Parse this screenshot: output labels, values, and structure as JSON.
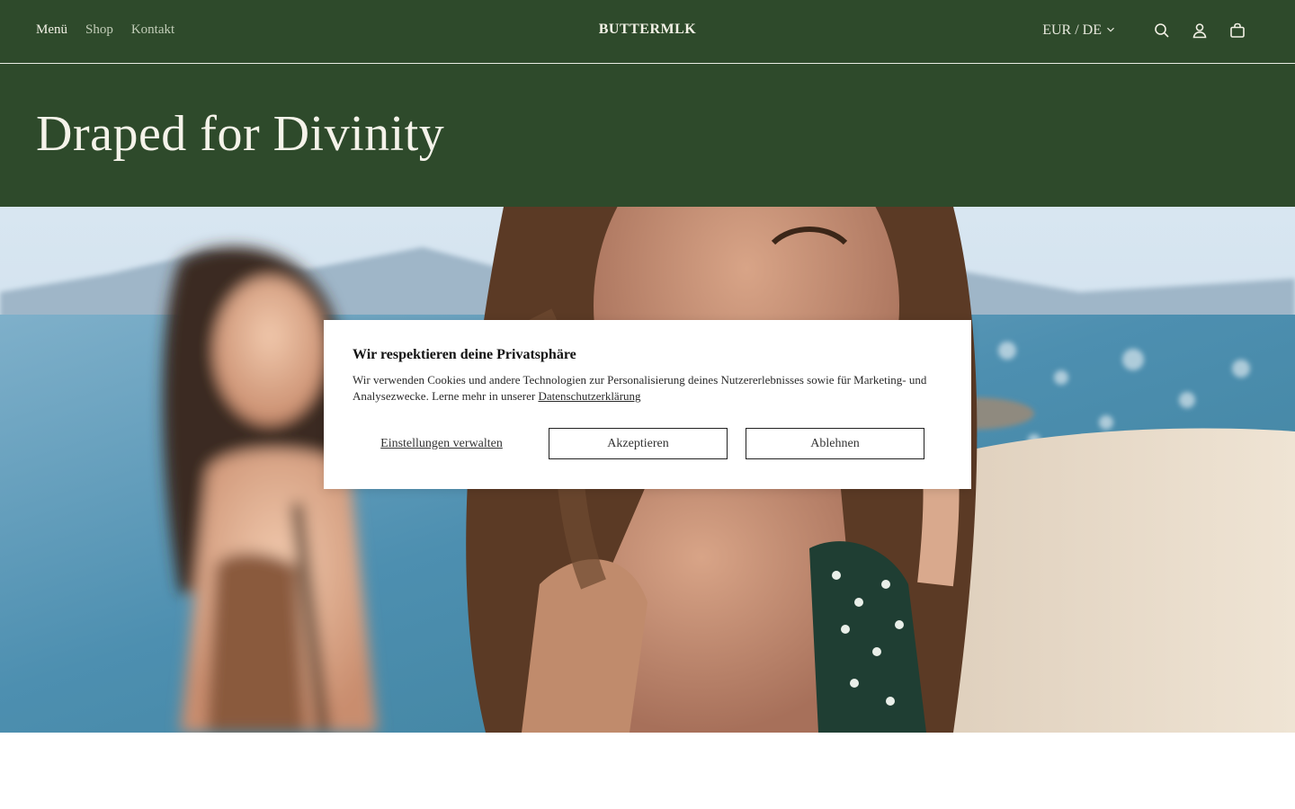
{
  "header": {
    "nav": [
      {
        "label": "Menü",
        "active": true
      },
      {
        "label": "Shop",
        "active": false
      },
      {
        "label": "Kontakt",
        "active": false
      }
    ],
    "logo": "BUTTERMLK",
    "currency": "EUR / DE",
    "icons": [
      "chevron-down-icon",
      "search-icon",
      "account-icon",
      "cart-icon"
    ]
  },
  "hero": {
    "title": "Draped for Divinity",
    "image": "two women smiling on a beach, sea and mountains in background"
  },
  "cookie_banner": {
    "title": "Wir respektieren deine Privatsphäre",
    "text": "Wir verwenden Cookies und andere Technologien zur Personalisierung deines Nutzererlebnisses sowie für Marketing- und Analysezwecke. Lerne mehr in unserer",
    "link": "Datenschutzerklärung",
    "settings_label": "Einstellungen verwalten",
    "accept_label": "Akzeptieren",
    "decline_label": "Ablehnen"
  },
  "colors": {
    "brand_green": "#2e4a2b",
    "header_text": "#f3f1e6"
  }
}
